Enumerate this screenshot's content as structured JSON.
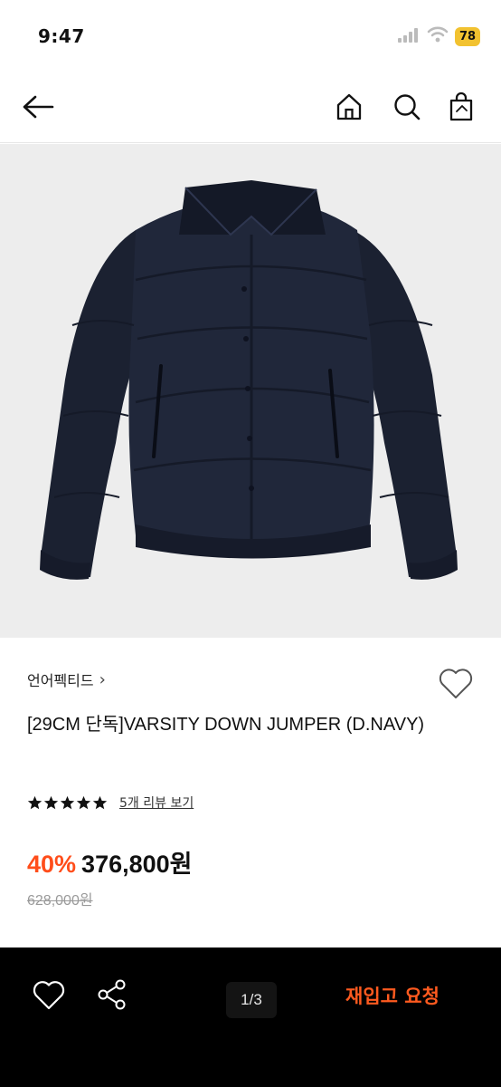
{
  "status_bar": {
    "time": "9:47",
    "battery": "78"
  },
  "header": {
    "back_icon": "arrow-left-icon",
    "home_icon": "home-icon",
    "search_icon": "search-icon",
    "bag_icon": "shopping-bag-icon"
  },
  "product": {
    "brand": "언어펙티드",
    "brand_chevron": "›",
    "title": "[29CM 단독]VARSITY DOWN JUMPER (D.NAVY)",
    "rating_stars": 5,
    "review_link": "5개 리뷰 보기",
    "discount": "40%",
    "price": "376,800원",
    "original_price": "628,000원"
  },
  "bottom_bar": {
    "pager": "1/3",
    "restock_label": "재입고 요청"
  },
  "colors": {
    "accent": "#ff4d1a",
    "navy": "#1c2233"
  }
}
